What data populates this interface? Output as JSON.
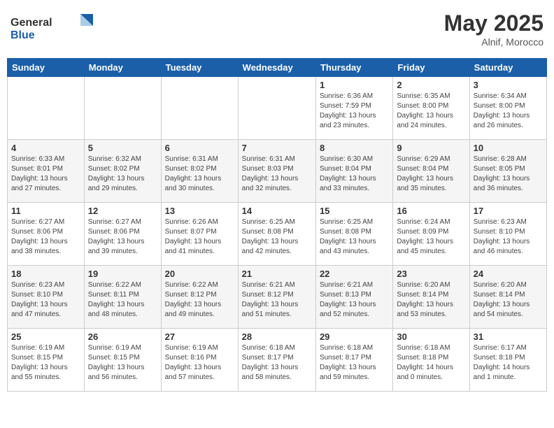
{
  "header": {
    "logo_general": "General",
    "logo_blue": "Blue",
    "month_year": "May 2025",
    "location": "Alnif, Morocco"
  },
  "weekdays": [
    "Sunday",
    "Monday",
    "Tuesday",
    "Wednesday",
    "Thursday",
    "Friday",
    "Saturday"
  ],
  "weeks": [
    {
      "days": [
        {
          "num": "",
          "info": ""
        },
        {
          "num": "",
          "info": ""
        },
        {
          "num": "",
          "info": ""
        },
        {
          "num": "",
          "info": ""
        },
        {
          "num": "1",
          "info": "Sunrise: 6:36 AM\nSunset: 7:59 PM\nDaylight: 13 hours\nand 23 minutes."
        },
        {
          "num": "2",
          "info": "Sunrise: 6:35 AM\nSunset: 8:00 PM\nDaylight: 13 hours\nand 24 minutes."
        },
        {
          "num": "3",
          "info": "Sunrise: 6:34 AM\nSunset: 8:00 PM\nDaylight: 13 hours\nand 26 minutes."
        }
      ]
    },
    {
      "days": [
        {
          "num": "4",
          "info": "Sunrise: 6:33 AM\nSunset: 8:01 PM\nDaylight: 13 hours\nand 27 minutes."
        },
        {
          "num": "5",
          "info": "Sunrise: 6:32 AM\nSunset: 8:02 PM\nDaylight: 13 hours\nand 29 minutes."
        },
        {
          "num": "6",
          "info": "Sunrise: 6:31 AM\nSunset: 8:02 PM\nDaylight: 13 hours\nand 30 minutes."
        },
        {
          "num": "7",
          "info": "Sunrise: 6:31 AM\nSunset: 8:03 PM\nDaylight: 13 hours\nand 32 minutes."
        },
        {
          "num": "8",
          "info": "Sunrise: 6:30 AM\nSunset: 8:04 PM\nDaylight: 13 hours\nand 33 minutes."
        },
        {
          "num": "9",
          "info": "Sunrise: 6:29 AM\nSunset: 8:04 PM\nDaylight: 13 hours\nand 35 minutes."
        },
        {
          "num": "10",
          "info": "Sunrise: 6:28 AM\nSunset: 8:05 PM\nDaylight: 13 hours\nand 36 minutes."
        }
      ]
    },
    {
      "days": [
        {
          "num": "11",
          "info": "Sunrise: 6:27 AM\nSunset: 8:06 PM\nDaylight: 13 hours\nand 38 minutes."
        },
        {
          "num": "12",
          "info": "Sunrise: 6:27 AM\nSunset: 8:06 PM\nDaylight: 13 hours\nand 39 minutes."
        },
        {
          "num": "13",
          "info": "Sunrise: 6:26 AM\nSunset: 8:07 PM\nDaylight: 13 hours\nand 41 minutes."
        },
        {
          "num": "14",
          "info": "Sunrise: 6:25 AM\nSunset: 8:08 PM\nDaylight: 13 hours\nand 42 minutes."
        },
        {
          "num": "15",
          "info": "Sunrise: 6:25 AM\nSunset: 8:08 PM\nDaylight: 13 hours\nand 43 minutes."
        },
        {
          "num": "16",
          "info": "Sunrise: 6:24 AM\nSunset: 8:09 PM\nDaylight: 13 hours\nand 45 minutes."
        },
        {
          "num": "17",
          "info": "Sunrise: 6:23 AM\nSunset: 8:10 PM\nDaylight: 13 hours\nand 46 minutes."
        }
      ]
    },
    {
      "days": [
        {
          "num": "18",
          "info": "Sunrise: 6:23 AM\nSunset: 8:10 PM\nDaylight: 13 hours\nand 47 minutes."
        },
        {
          "num": "19",
          "info": "Sunrise: 6:22 AM\nSunset: 8:11 PM\nDaylight: 13 hours\nand 48 minutes."
        },
        {
          "num": "20",
          "info": "Sunrise: 6:22 AM\nSunset: 8:12 PM\nDaylight: 13 hours\nand 49 minutes."
        },
        {
          "num": "21",
          "info": "Sunrise: 6:21 AM\nSunset: 8:12 PM\nDaylight: 13 hours\nand 51 minutes."
        },
        {
          "num": "22",
          "info": "Sunrise: 6:21 AM\nSunset: 8:13 PM\nDaylight: 13 hours\nand 52 minutes."
        },
        {
          "num": "23",
          "info": "Sunrise: 6:20 AM\nSunset: 8:14 PM\nDaylight: 13 hours\nand 53 minutes."
        },
        {
          "num": "24",
          "info": "Sunrise: 6:20 AM\nSunset: 8:14 PM\nDaylight: 13 hours\nand 54 minutes."
        }
      ]
    },
    {
      "days": [
        {
          "num": "25",
          "info": "Sunrise: 6:19 AM\nSunset: 8:15 PM\nDaylight: 13 hours\nand 55 minutes."
        },
        {
          "num": "26",
          "info": "Sunrise: 6:19 AM\nSunset: 8:15 PM\nDaylight: 13 hours\nand 56 minutes."
        },
        {
          "num": "27",
          "info": "Sunrise: 6:19 AM\nSunset: 8:16 PM\nDaylight: 13 hours\nand 57 minutes."
        },
        {
          "num": "28",
          "info": "Sunrise: 6:18 AM\nSunset: 8:17 PM\nDaylight: 13 hours\nand 58 minutes."
        },
        {
          "num": "29",
          "info": "Sunrise: 6:18 AM\nSunset: 8:17 PM\nDaylight: 13 hours\nand 59 minutes."
        },
        {
          "num": "30",
          "info": "Sunrise: 6:18 AM\nSunset: 8:18 PM\nDaylight: 14 hours\nand 0 minutes."
        },
        {
          "num": "31",
          "info": "Sunrise: 6:17 AM\nSunset: 8:18 PM\nDaylight: 14 hours\nand 1 minute."
        }
      ]
    }
  ]
}
